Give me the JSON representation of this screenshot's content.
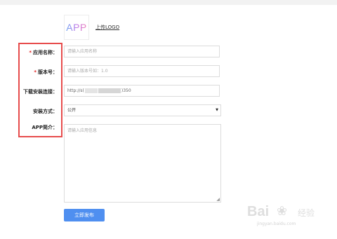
{
  "logo": {
    "text": "APP",
    "upload_label": "上传LOGO"
  },
  "form": {
    "required_mark": "*",
    "app_name": {
      "label": "应用名称：",
      "placeholder": "请输入应用名称",
      "required": true
    },
    "version": {
      "label": "版本号：",
      "placeholder": "请输入版本号如：1.0",
      "required": true
    },
    "download_link": {
      "label": "下载安装连接：",
      "value_prefix": "http://s(",
      "value_suffix": ")350"
    },
    "install_method": {
      "label": "安装方式：",
      "selected": "公开"
    },
    "app_intro": {
      "label": "APP简介：",
      "placeholder": "请输入应用信息"
    }
  },
  "publish_button": {
    "label": "立即发布"
  },
  "watermark": {
    "brand": "Bai",
    "brand_tail": "经验",
    "url": "jingyan.baidu.com"
  },
  "colors": {
    "accent_button": "#4f8ff0",
    "highlight_border": "#e74c4c",
    "required": "#e02020"
  }
}
